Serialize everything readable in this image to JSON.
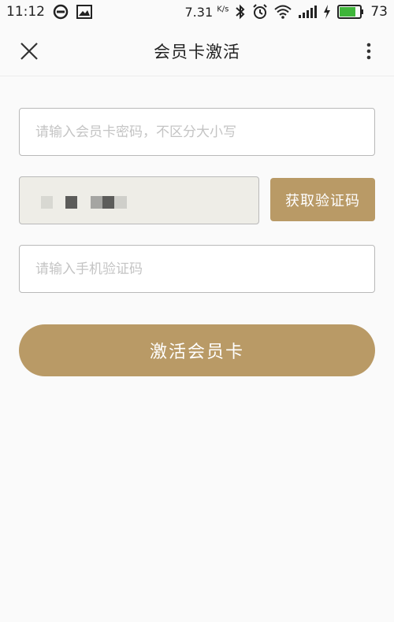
{
  "status_bar": {
    "time": "11:12",
    "speed": "7.31",
    "speed_unit": "K/s",
    "battery": "73"
  },
  "header": {
    "title": "会员卡激活"
  },
  "form": {
    "card_placeholder": "请输入会员卡密码，不区分大小写",
    "get_code_label": "获取验证码",
    "code_placeholder": "请输入手机验证码",
    "activate_label": "激活会员卡"
  },
  "colors": {
    "accent": "#b99a66",
    "phone_bg": "#eeede7"
  },
  "icons": {
    "close": "close-icon",
    "more": "more-vertical-icon",
    "sync": "sync-icon",
    "image": "image-icon",
    "bluetooth": "bluetooth-icon",
    "alarm": "alarm-icon",
    "wifi": "wifi-icon",
    "signal": "signal-icon",
    "charging": "charging-icon",
    "battery": "battery-icon"
  }
}
